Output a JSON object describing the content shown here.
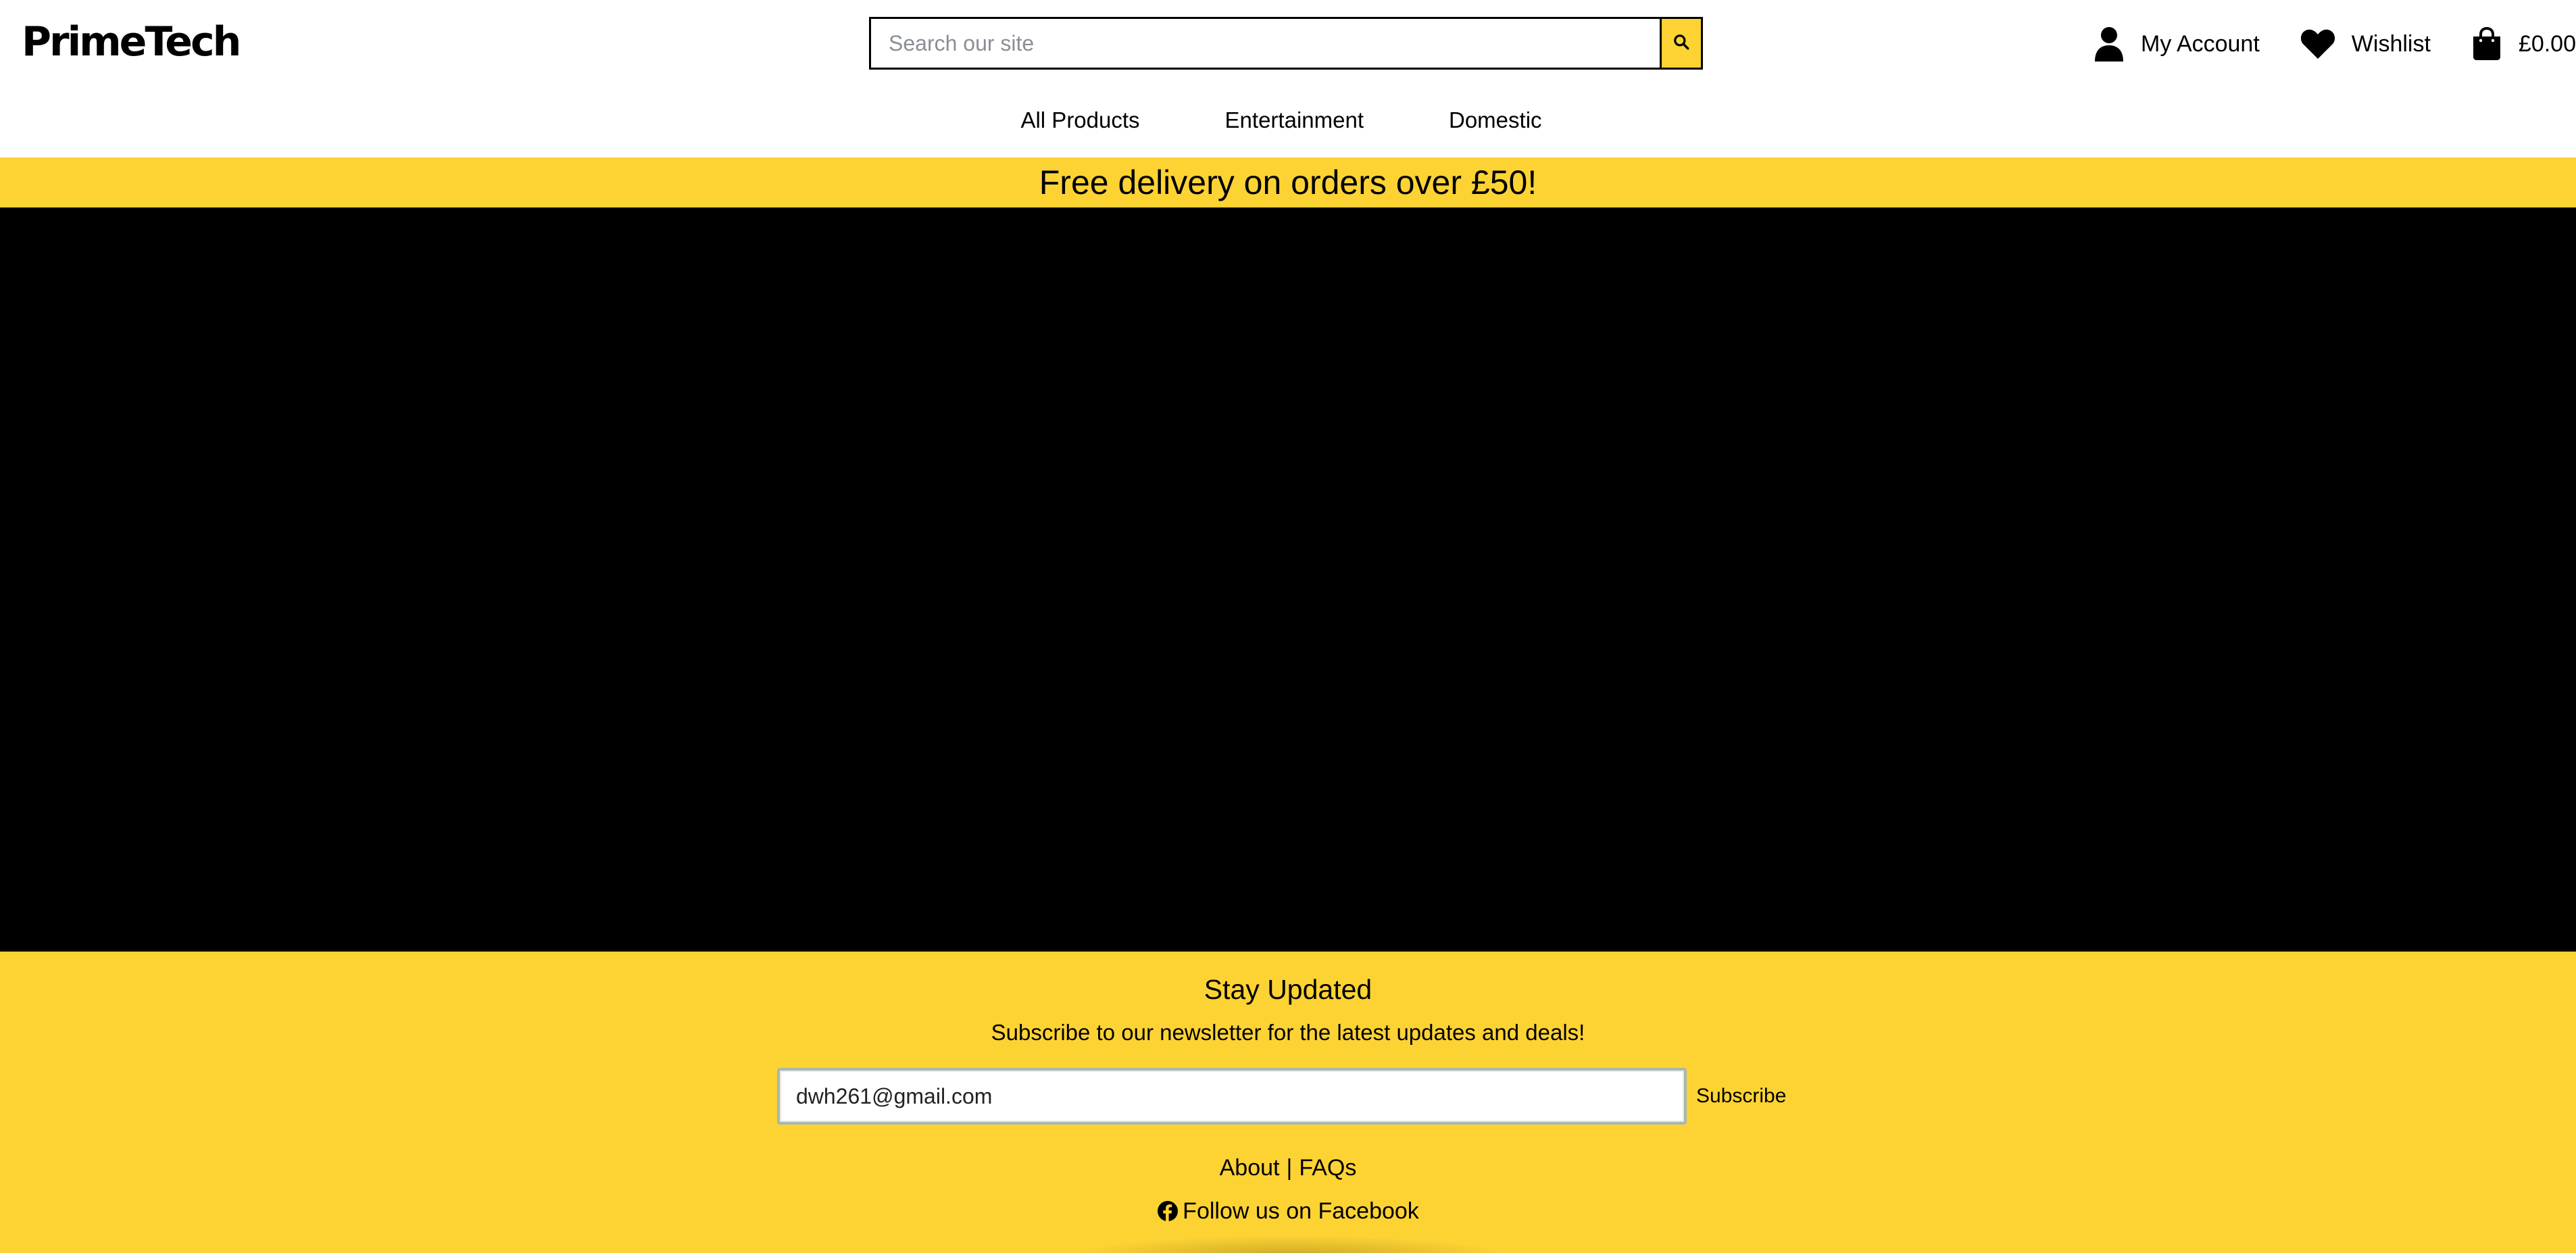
{
  "header": {
    "logo": "PrimeTech",
    "search": {
      "placeholder": "Search our site",
      "value": ""
    },
    "account": {
      "my_account": "My Account",
      "wishlist": "Wishlist",
      "cart_total": "£0.00"
    },
    "icons": {
      "search": "search-icon",
      "user": "user-icon",
      "wishlist": "heart-icon",
      "cart": "shopping-bag-icon"
    }
  },
  "nav": {
    "items": [
      "All Products",
      "Entertainment",
      "Domestic"
    ]
  },
  "promo": {
    "text": "Free delivery on orders over £50!"
  },
  "footer": {
    "title": "Stay Updated",
    "subtitle": "Subscribe to our newsletter for the latest updates and deals!",
    "email_value": "dwh261@gmail.com",
    "subscribe_label": "Subscribe",
    "links": [
      "About",
      "FAQs"
    ],
    "link_separator": "|",
    "facebook_label": "Follow us on Facebook",
    "facebook_icon": "facebook-icon"
  },
  "colors": {
    "accent_yellow": "#fdd334",
    "hero_background": "#000000",
    "text": "#000000"
  }
}
